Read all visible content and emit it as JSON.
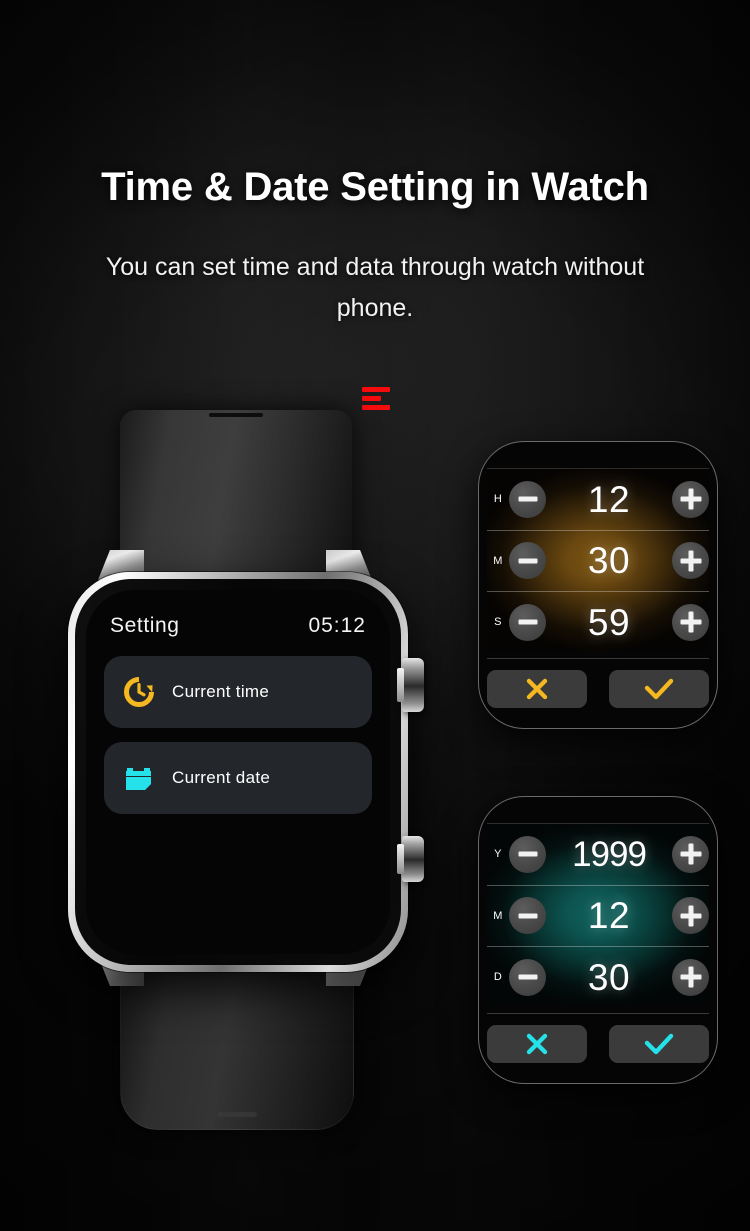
{
  "page": {
    "title": "Time & Date Setting in Watch",
    "subtitle": "You can set time and data through watch without phone."
  },
  "brand": {
    "logo_icon": "hamburger-bars-logo",
    "color": "#f50d0d"
  },
  "watch": {
    "screen": {
      "header_title": "Setting",
      "header_clock": "05:12",
      "menu_items": [
        {
          "icon": "clock-restore-icon",
          "icon_color": "#f5b820",
          "label": "Current time"
        },
        {
          "icon": "calendar-icon",
          "icon_color": "#25e2ea",
          "label": "Current date"
        }
      ]
    },
    "hardware": {
      "case_finish": "silver",
      "strap_color": "#2f2f2f",
      "side_buttons": 2
    }
  },
  "pickers": [
    {
      "id": "time-picker",
      "accent": "#f5b820",
      "glow_color": "#7a5410",
      "rows": [
        {
          "label": "H",
          "value": "12",
          "decrement_icon": "minus-icon",
          "increment_icon": "plus-icon"
        },
        {
          "label": "M",
          "value": "30",
          "decrement_icon": "minus-icon",
          "increment_icon": "plus-icon"
        },
        {
          "label": "S",
          "value": "59",
          "decrement_icon": "minus-icon",
          "increment_icon": "plus-icon"
        }
      ],
      "actions": [
        {
          "icon": "close-x-icon",
          "role": "cancel"
        },
        {
          "icon": "check-icon",
          "role": "confirm"
        }
      ]
    },
    {
      "id": "date-picker",
      "accent": "#25e2ea",
      "glow_color": "#10615c",
      "rows": [
        {
          "label": "Y",
          "value": "1999",
          "decrement_icon": "minus-icon",
          "increment_icon": "plus-icon"
        },
        {
          "label": "M",
          "value": "12",
          "decrement_icon": "minus-icon",
          "increment_icon": "plus-icon"
        },
        {
          "label": "D",
          "value": "30",
          "decrement_icon": "minus-icon",
          "increment_icon": "plus-icon"
        }
      ],
      "actions": [
        {
          "icon": "close-x-icon",
          "role": "cancel"
        },
        {
          "icon": "check-icon",
          "role": "confirm"
        }
      ]
    }
  ]
}
